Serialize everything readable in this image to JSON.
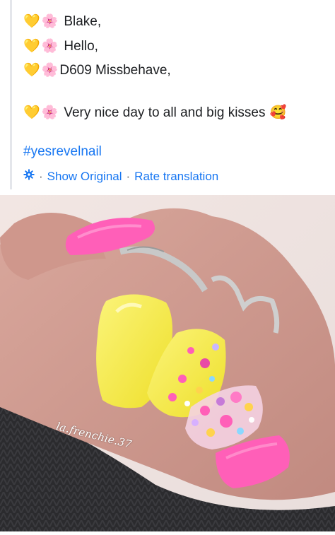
{
  "post": {
    "lines": [
      {
        "icons": [
          "yellow-heart",
          "blossom"
        ],
        "text": "Blake,"
      },
      {
        "icons": [
          "yellow-heart",
          "blossom"
        ],
        "text": "Hello,"
      },
      {
        "icons": [
          "yellow-heart",
          "blossom"
        ],
        "text": "D609 Missbehave,"
      },
      {
        "icons": [
          "yellow-heart",
          "blossom"
        ],
        "text": "Very nice day to all and big kisses",
        "trailing_icon": "smiling-face-with-hearts"
      }
    ],
    "hashtag": "#yesrevelnail",
    "translation": {
      "icon": "gear-icon",
      "separator": "·",
      "show_original": "Show Original",
      "rate_translation": "Rate translation"
    }
  },
  "photo": {
    "subject": "manicured-nails",
    "watermark": "la.frenchie.37"
  },
  "colors": {
    "link": "#1877f2",
    "text": "#1c1e21",
    "border": "#e4e6eb",
    "nail_pink": "#ff5fb8",
    "nail_yellow": "#f4ec3c"
  }
}
